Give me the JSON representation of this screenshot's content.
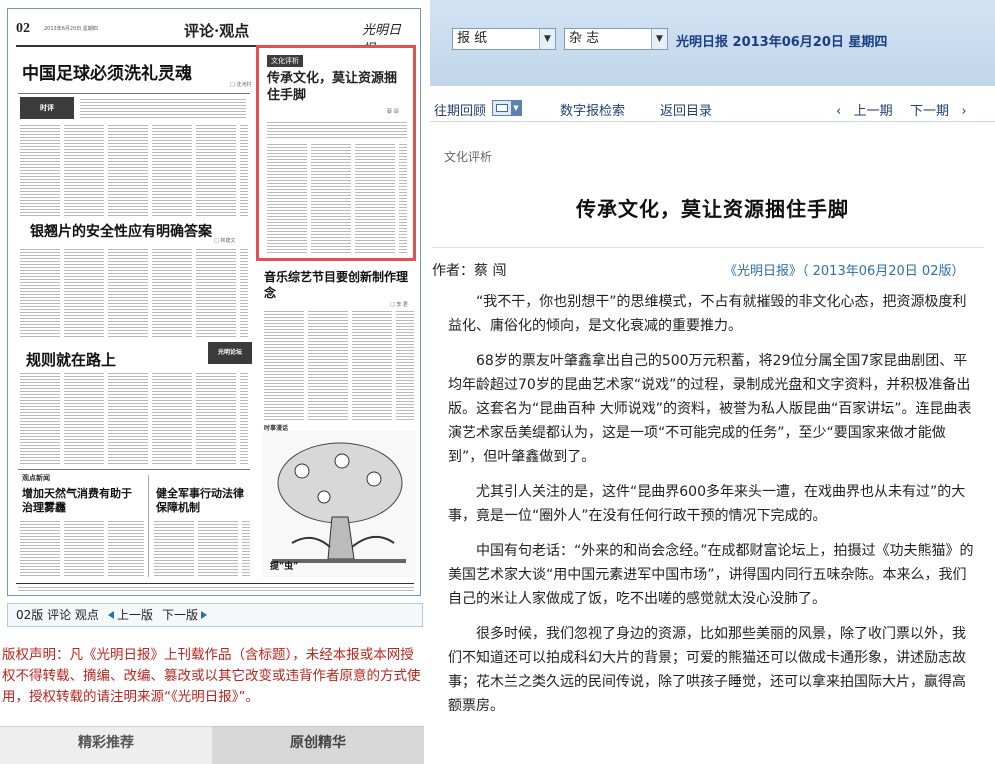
{
  "newspaper": {
    "page_number": "02",
    "date_line": "2013年6月20日 星期四",
    "section": "评论·观点",
    "masthead": "光明日报",
    "headlines": {
      "h1": "中国足球必须洗礼灵魂",
      "h2": "银翘片的安全性应有明确答案",
      "h3": "规则就在路上",
      "h4": "音乐综艺节目要创新制作理念",
      "h5": "增加天然气消费有助于治理雾霾",
      "h6": "健全军事行动法律保障机制"
    },
    "col_tags": {
      "shiping": "时评",
      "guandian": "观点新闻",
      "shishi": "时事漫话",
      "cartoon_caption": "提“虫”",
      "logo": "光明论坛"
    },
    "highlight": {
      "tag": "文化评析",
      "title": "传承文化，莫让资源捆住手脚",
      "author": "蔡 闯"
    }
  },
  "page_nav": {
    "label": "02版 评论 观点",
    "prev": "上一版",
    "next": "下一版"
  },
  "copyright": "版权声明：凡《光明日报》上刊载作品（含标题），未经本报或本网授权不得转载、摘编、改编、篡改或以其它改变或违背作者原意的方式使用，授权转载的请注明来源“《光明日报》”。",
  "tabs": {
    "featured": "精彩推荐",
    "original": "原创精华"
  },
  "topbar": {
    "select_paper": "报 纸",
    "select_magazine": "杂 志",
    "publication_date": "光明日报 2013年06月20日 星期四"
  },
  "navbar": {
    "archive": "往期回顾",
    "search": "数字报检索",
    "back": "返回目录",
    "prev": "上一期",
    "next": "下一期"
  },
  "article": {
    "category": "文化评析",
    "title": "传承文化，莫让资源捆住手脚",
    "author": "作者：蔡 闯",
    "source": "《光明日报》（ 2013年06月20日   02版）",
    "paragraphs": [
      "“我不干，你也别想干”的思维模式，不占有就摧毁的非文化心态，把资源极度利益化、庸俗化的倾向，是文化衰减的重要推力。",
      "68岁的票友叶肇鑫拿出自己的500万元积蓄，将29位分属全国7家昆曲剧团、平均年龄超过70岁的昆曲艺术家“说戏”的过程，录制成光盘和文字资料，并积极准备出版。这套名为“昆曲百种  大师说戏”的资料，被誉为私人版昆曲“百家讲坛”。连昆曲表演艺术家岳美缇都认为，这是一项“不可能完成的任务”，至少“要国家来做才能做到”，但叶肇鑫做到了。",
      "尤其引人关注的是，这件“昆曲界600多年来头一遭，在戏曲界也从未有过”的大事，竟是一位“圈外人”在没有任何行政干预的情况下完成的。",
      "中国有句老话：“外来的和尚会念经。”在成都财富论坛上，拍摄过《功夫熊猫》的美国艺术家大谈“用中国元素进军中国市场”，讲得国内同行五味杂陈。本来么，我们自己的米让人家做成了饭，吃不出嗟的感觉就太没心没肺了。",
      "很多时候，我们忽视了身边的资源，比如那些美丽的风景，除了收门票以外，我们不知道还可以拍成科幻大片的背景；可爱的熊猫还可以做成卡通形象，讲述励志故事；花木兰之类久远的民间传说，除了哄孩子睡觉，还可以拿来拍国际大片，赢得高额票房。"
    ]
  }
}
